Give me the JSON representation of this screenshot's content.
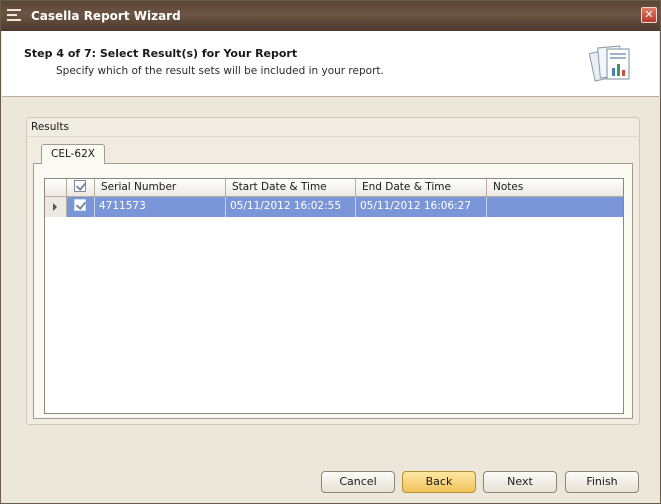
{
  "window": {
    "title": "Casella Report Wizard",
    "close_glyph": "✕"
  },
  "header": {
    "step_title": "Step 4 of 7: Select Result(s) for Your Report",
    "step_description": "Specify which of the result sets will be included in your report.",
    "icon": "report-documents-icon"
  },
  "results": {
    "group_label": "Results",
    "tabs": [
      {
        "label": "CEL-62X",
        "selected": true
      }
    ],
    "columns": [
      "",
      "Serial Number",
      "Start Date & Time",
      "End Date & Time",
      "Notes"
    ],
    "rows": [
      {
        "checked": true,
        "selected": true,
        "serial_number": "4711573",
        "start": "05/11/2012 16:02:55",
        "end": "05/11/2012 16:06:27",
        "notes": ""
      }
    ]
  },
  "buttons": {
    "cancel": "Cancel",
    "back": "Back",
    "next": "Next",
    "finish": "Finish"
  },
  "colors": {
    "titlebar": "#5a4636",
    "selection": "#7b95d9",
    "primary_button": "#f3c35a"
  }
}
